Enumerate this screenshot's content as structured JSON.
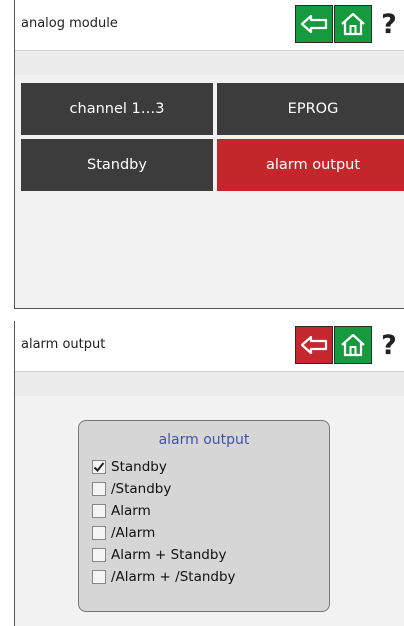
{
  "panel1": {
    "title": "analog module",
    "help_label": "?",
    "tiles": [
      {
        "label": "channel 1…3"
      },
      {
        "label": "EPROG"
      },
      {
        "label": "Standby"
      },
      {
        "label": "alarm output"
      }
    ]
  },
  "panel2": {
    "title": "alarm output",
    "help_label": "?",
    "group_title": "alarm output",
    "options": [
      {
        "label": "Standby",
        "checked": true
      },
      {
        "label": "/Standby",
        "checked": false
      },
      {
        "label": "Alarm",
        "checked": false
      },
      {
        "label": "/Alarm",
        "checked": false
      },
      {
        "label": "Alarm + Standby",
        "checked": false
      },
      {
        "label": "/Alarm + /Standby",
        "checked": false
      }
    ]
  },
  "colors": {
    "accent_green": "#159a3e",
    "accent_red": "#c5272f",
    "tile_dark": "#3c3c3c",
    "group_title": "#3f54a8"
  },
  "icons": {
    "back": "back-arrow-icon",
    "home": "home-icon",
    "help": "help-icon"
  }
}
